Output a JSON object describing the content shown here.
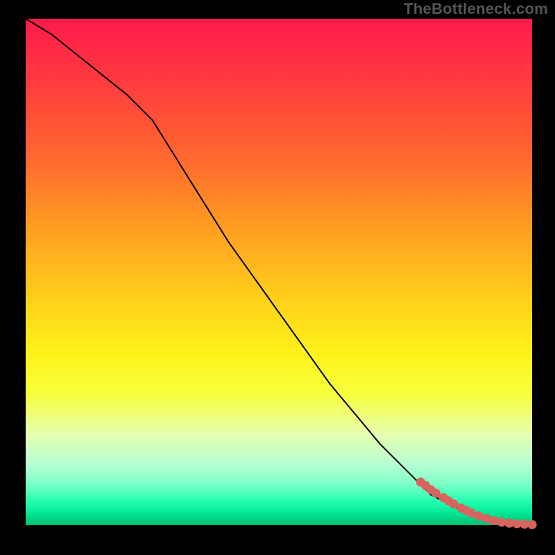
{
  "watermark": "TheBottleneck.com",
  "colors": {
    "page_bg": "#000000",
    "gradient_top": "#ff1a4b",
    "gradient_bottom": "#00c070",
    "curve": "#000000",
    "marker": "#d9645f",
    "watermark": "#555555"
  },
  "chart_data": {
    "type": "line",
    "title": "",
    "xlabel": "",
    "ylabel": "",
    "xlim": [
      0,
      100
    ],
    "ylim": [
      0,
      100
    ],
    "grid": false,
    "legend": false,
    "series": [
      {
        "name": "curve",
        "x": [
          0,
          5,
          10,
          15,
          20,
          25,
          30,
          35,
          40,
          45,
          50,
          55,
          60,
          65,
          70,
          75,
          80,
          82,
          84,
          86,
          88,
          90,
          92,
          94,
          96,
          98,
          100
        ],
        "y": [
          100,
          97,
          93,
          89,
          85,
          80,
          72,
          64,
          56,
          49,
          42,
          35,
          28,
          22,
          16,
          11,
          6,
          5,
          4,
          3,
          2,
          1.5,
          1,
          0.7,
          0.4,
          0.2,
          0
        ]
      }
    ],
    "highlight_points": {
      "name": "markers",
      "x": [
        78,
        79,
        80,
        81,
        82.5,
        83.5,
        84.5,
        86,
        87,
        88,
        89.5,
        91,
        92.5,
        94,
        95.5,
        97,
        98.5,
        100
      ],
      "y": [
        8.5,
        7.8,
        7.0,
        6.3,
        5.4,
        4.8,
        4.2,
        3.4,
        2.9,
        2.4,
        1.8,
        1.3,
        0.9,
        0.6,
        0.4,
        0.3,
        0.2,
        0.1
      ]
    }
  }
}
